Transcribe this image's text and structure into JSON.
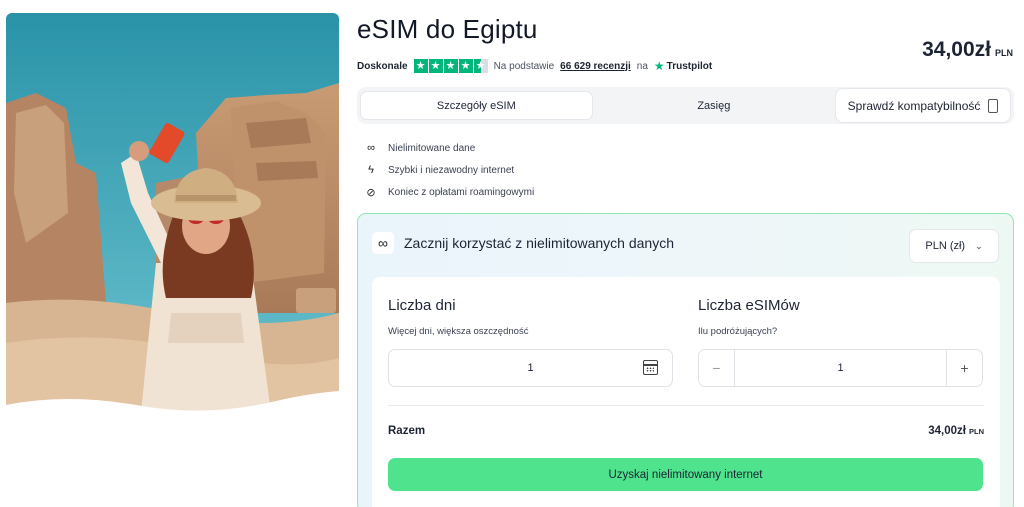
{
  "product": {
    "title": "eSIM do Egiptu",
    "price": "34,00zł",
    "currency_code": "PLN"
  },
  "rating": {
    "label": "Doskonale",
    "stars": 4.5,
    "based_on": "Na podstawie",
    "reviews": "66 629 recenzji",
    "on": "na",
    "provider": "Trustpilot"
  },
  "tabs": [
    {
      "label": "Szczegóły eSIM",
      "active": true
    },
    {
      "label": "Zasięg",
      "active": false
    },
    {
      "label": "Sprawdź kompatybilność",
      "active": false
    }
  ],
  "features": [
    {
      "icon": "infinity-icon",
      "text": "Nielimitowane dane"
    },
    {
      "icon": "lightning-icon",
      "text": "Szybki i niezawodny internet"
    },
    {
      "icon": "no-roaming-icon",
      "text": "Koniec z opłatami roamingowymi"
    }
  ],
  "panel": {
    "heading": "Zacznij korzystać z nielimitowanych danych",
    "currency_select": "PLN (zł)",
    "days": {
      "title": "Liczba dni",
      "subtitle": "Więcej dni, większa oszczędność",
      "value": "1"
    },
    "esims": {
      "title": "Liczba eSIMów",
      "subtitle": "Ilu podróżujących?",
      "value": "1",
      "minus": "−",
      "plus": "+"
    },
    "total_label": "Razem",
    "total_amount": "34,00zł",
    "total_currency": "PLN",
    "cta": "Uzyskaj nielimitowany internet"
  },
  "colors": {
    "accent_green": "#4ee38c",
    "trustpilot_green": "#00b67a",
    "panel_border": "#8fe8b0"
  }
}
